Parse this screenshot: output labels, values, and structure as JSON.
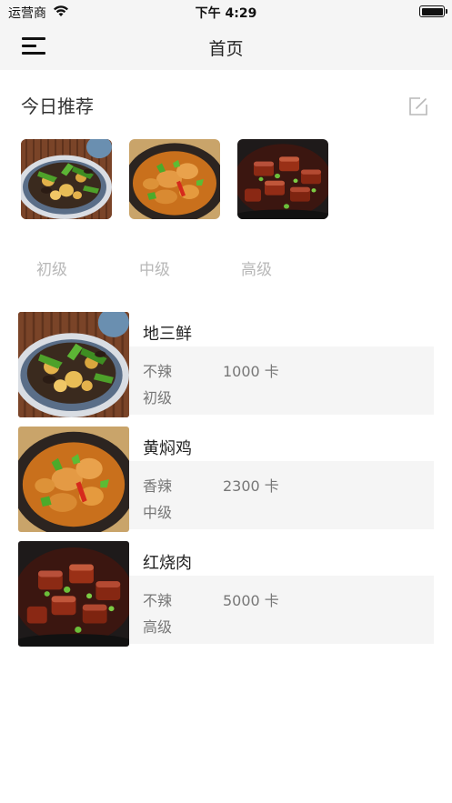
{
  "status_bar": {
    "carrier": "运营商",
    "time": "下午 4:29"
  },
  "nav": {
    "title": "首页"
  },
  "recommend": {
    "title": "今日推荐",
    "levels": [
      "初级",
      "中级",
      "高级"
    ]
  },
  "dishes": [
    {
      "name": "地三鲜",
      "spice": "不辣",
      "calories": "1000 卡",
      "level": "初级"
    },
    {
      "name": "黄焖鸡",
      "spice": "香辣",
      "calories": "2300 卡",
      "level": "中级"
    },
    {
      "name": "红烧肉",
      "spice": "不辣",
      "calories": "5000 卡",
      "level": "高级"
    }
  ],
  "icons": {
    "menu": "hamburger-menu-icon",
    "edit": "edit-icon",
    "wifi": "wifi-icon",
    "battery": "battery-icon"
  }
}
